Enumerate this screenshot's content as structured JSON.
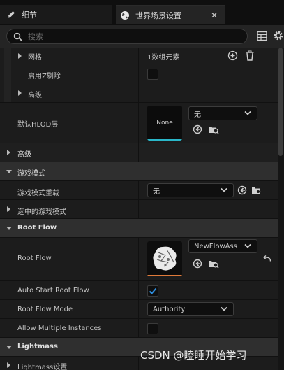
{
  "tabs": [
    {
      "label": "细节"
    },
    {
      "label": "世界场景设置",
      "close": "✕"
    }
  ],
  "search": {
    "placeholder": "搜索"
  },
  "rows": {
    "grid": {
      "label": "网格",
      "value": "1数组元素"
    },
    "enable_z_cull": {
      "label": "启用Z剔除"
    },
    "advanced_1": {
      "label": "高级"
    },
    "default_hlod": {
      "label": "默认HLOD层",
      "thumb_text": "None",
      "combo_value": "无"
    },
    "advanced_2": {
      "label": "高级"
    },
    "game_mode_cat": {
      "label": "游戏模式"
    },
    "game_mode_override": {
      "label": "游戏模式重载",
      "combo_value": "无"
    },
    "selected_game_mode": {
      "label": "选中的游戏模式"
    },
    "root_flow_cat": {
      "label": "Root Flow"
    },
    "root_flow": {
      "label": "Root Flow",
      "combo_value": "NewFlowAss"
    },
    "auto_start": {
      "label": "Auto Start Root Flow",
      "checked": true
    },
    "root_flow_mode": {
      "label": "Root Flow Mode",
      "combo_value": "Authority"
    },
    "allow_multiple": {
      "label": "Allow Multiple Instances"
    },
    "lightmass_cat": {
      "label": "Lightmass"
    },
    "lightmass_settings": {
      "label": "Lightmass设置"
    }
  },
  "watermark": "CSDN @瞌睡开始学习",
  "colors": {
    "accent_teal": "#2ab7c9",
    "accent_orange": "#e07a3a",
    "check_blue": "#2f8fe0"
  }
}
